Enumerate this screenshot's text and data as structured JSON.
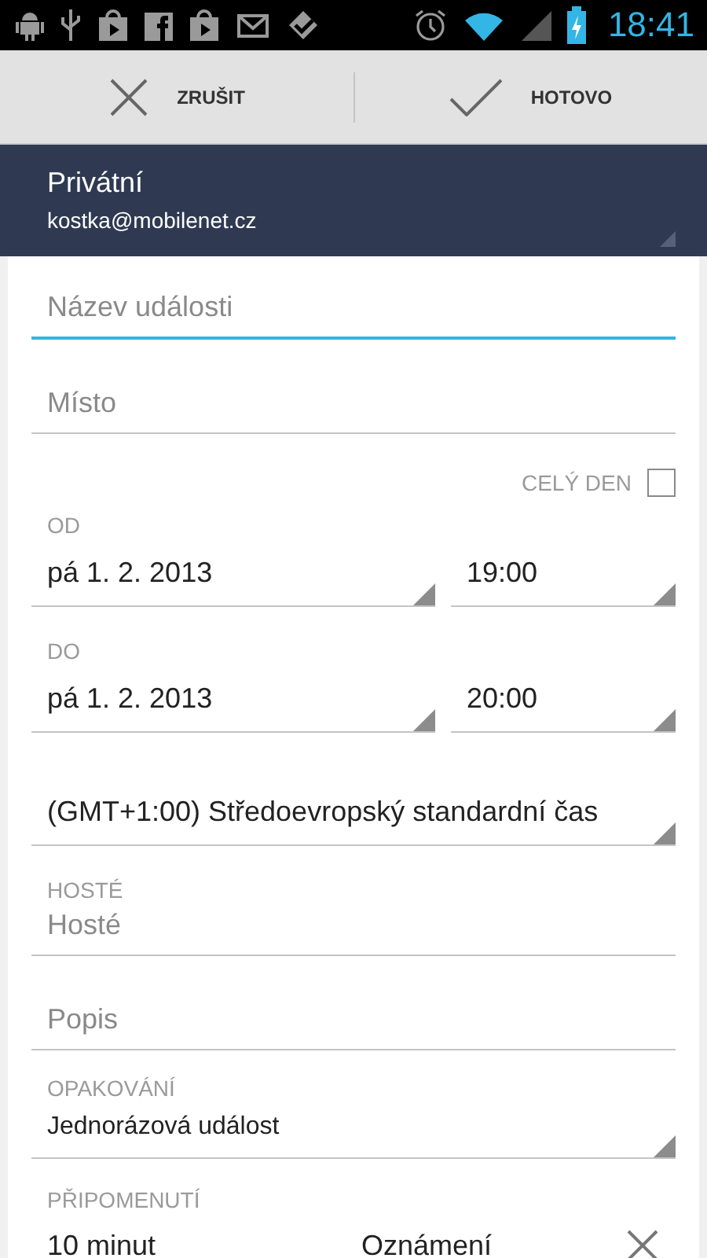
{
  "status_bar": {
    "time": "18:41"
  },
  "action_bar": {
    "buttons": [
      {
        "kind": "cancel",
        "label": "ZRUŠIT"
      },
      {
        "kind": "done",
        "label": "HOTOVO"
      }
    ]
  },
  "account": {
    "name": "Privátní",
    "email": "kostka@mobilenet.cz"
  },
  "form": {
    "title": {
      "placeholder": "Název události",
      "focused": true
    },
    "location": {
      "placeholder": "Místo",
      "focused": false
    },
    "all_day": {
      "label": "CELÝ DEN",
      "checked": false
    },
    "from": {
      "label": "OD",
      "date": "pá 1. 2. 2013",
      "time": "19:00"
    },
    "to": {
      "label": "DO",
      "date": "pá 1. 2. 2013",
      "time": "20:00"
    },
    "timezone": {
      "value": "(GMT+1:00) Středoevropský standardní čas"
    },
    "guests": {
      "label": "HOSTÉ",
      "placeholder": "Hosté",
      "focused": false
    },
    "description": {
      "placeholder": "Popis",
      "focused": false
    },
    "repeat": {
      "label": "OPAKOVÁNÍ",
      "value": "Jednorázová událost"
    },
    "reminders": {
      "label": "PŘIPOMENUTÍ",
      "items": [
        {
          "time": "10 minut",
          "method": "Oznámení"
        }
      ]
    }
  }
}
